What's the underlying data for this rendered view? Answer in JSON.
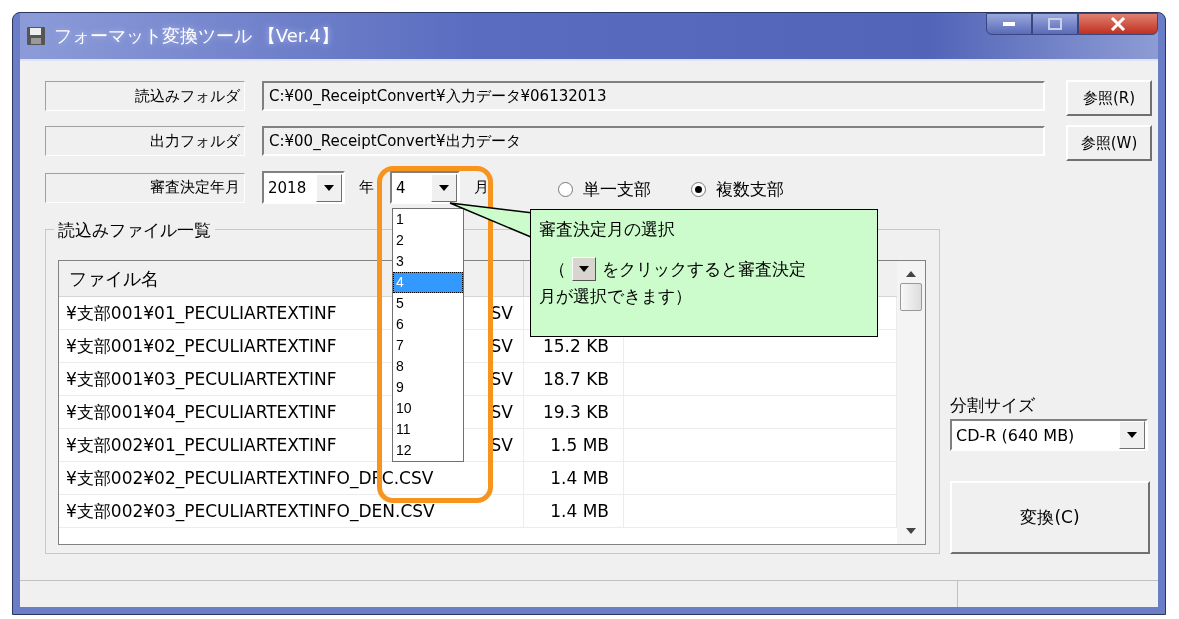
{
  "window": {
    "title": "フォーマット変換ツール 【Ver.4】"
  },
  "folders": [
    {
      "label": "読込みフォルダ",
      "path": "C:¥00_ReceiptConvert¥入力データ¥06132013",
      "button": "参照(R)"
    },
    {
      "label": "出力フォルダ",
      "path": "C:¥00_ReceiptConvert¥出力データ",
      "button": "参照(W)"
    }
  ],
  "review": {
    "label": "審査決定年月",
    "year": "2018",
    "year_unit": "年",
    "month": "4",
    "month_unit": "月"
  },
  "branch_options": [
    {
      "label": "単一支部",
      "selected": false
    },
    {
      "label": "複数支部",
      "selected": true
    }
  ],
  "month_list": [
    {
      "label": "1",
      "selected": false
    },
    {
      "label": "2",
      "selected": false
    },
    {
      "label": "3",
      "selected": false
    },
    {
      "label": "4",
      "selected": true
    },
    {
      "label": "5",
      "selected": false
    },
    {
      "label": "6",
      "selected": false
    },
    {
      "label": "7",
      "selected": false
    },
    {
      "label": "8",
      "selected": false
    },
    {
      "label": "9",
      "selected": false
    },
    {
      "label": "10",
      "selected": false
    },
    {
      "label": "11",
      "selected": false
    },
    {
      "label": "12",
      "selected": false
    }
  ],
  "file_list": {
    "title": "読込みファイル一覧",
    "columns": [
      "ファイル名"
    ],
    "rows": [
      {
        "name": "¥支部001¥01_PECULIARTEXTINF",
        "tail": "SV"
      },
      {
        "name": "¥支部001¥02_PECULIARTEXTINF",
        "tail": "SV",
        "size": "15.2 KB"
      },
      {
        "name": "¥支部001¥03_PECULIARTEXTINF",
        "tail": "SV",
        "size": "18.7 KB"
      },
      {
        "name": "¥支部001¥04_PECULIARTEXTINF",
        "tail": "SV",
        "size": "19.3 KB"
      },
      {
        "name": "¥支部002¥01_PECULIARTEXTINF",
        "tail": "SV",
        "size": "1.5 MB"
      },
      {
        "name": "¥支部002¥02_PECULIARTEXTINFO_DPC.CSV",
        "size": "1.4 MB"
      },
      {
        "name": "¥支部002¥03_PECULIARTEXTINFO_DEN.CSV",
        "size": "1.4 MB"
      }
    ]
  },
  "split": {
    "label": "分割サイズ",
    "value": "CD-R (640 MB)"
  },
  "convert_button": "変換(C)",
  "callout": {
    "title": "審査決定月の選択",
    "open": "（",
    "line1": "をクリックすると審査決定",
    "line2": "月が選択できます）"
  }
}
